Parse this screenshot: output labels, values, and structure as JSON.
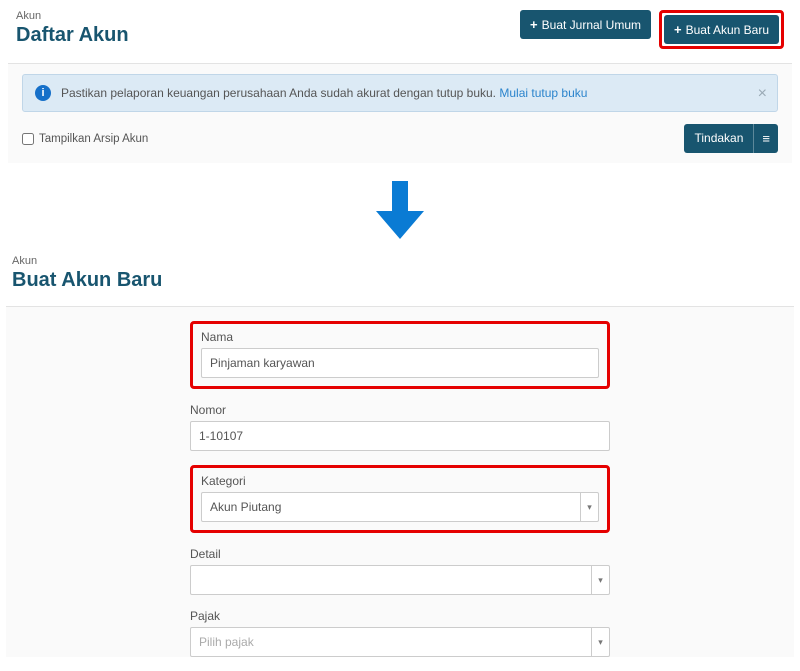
{
  "top": {
    "breadcrumb": "Akun",
    "title": "Daftar Akun",
    "btn_journal": "Buat Jurnal Umum",
    "btn_new_account": "Buat Akun Baru"
  },
  "alert": {
    "text": "Pastikan pelaporan keuangan perusahaan Anda sudah akurat dengan tutup buku.",
    "link": "Mulai tutup buku"
  },
  "archive_label": "Tampilkan Arsip Akun",
  "tindakan_label": "Tindakan",
  "form_page": {
    "breadcrumb": "Akun",
    "title": "Buat Akun Baru"
  },
  "form": {
    "nama": {
      "label": "Nama",
      "value": "Pinjaman karyawan"
    },
    "nomor": {
      "label": "Nomor",
      "value": "1-10107"
    },
    "kategori": {
      "label": "Kategori",
      "value": "Akun Piutang"
    },
    "detail": {
      "label": "Detail",
      "value": ""
    },
    "pajak": {
      "label": "Pajak",
      "placeholder": "Pilih pajak"
    }
  }
}
